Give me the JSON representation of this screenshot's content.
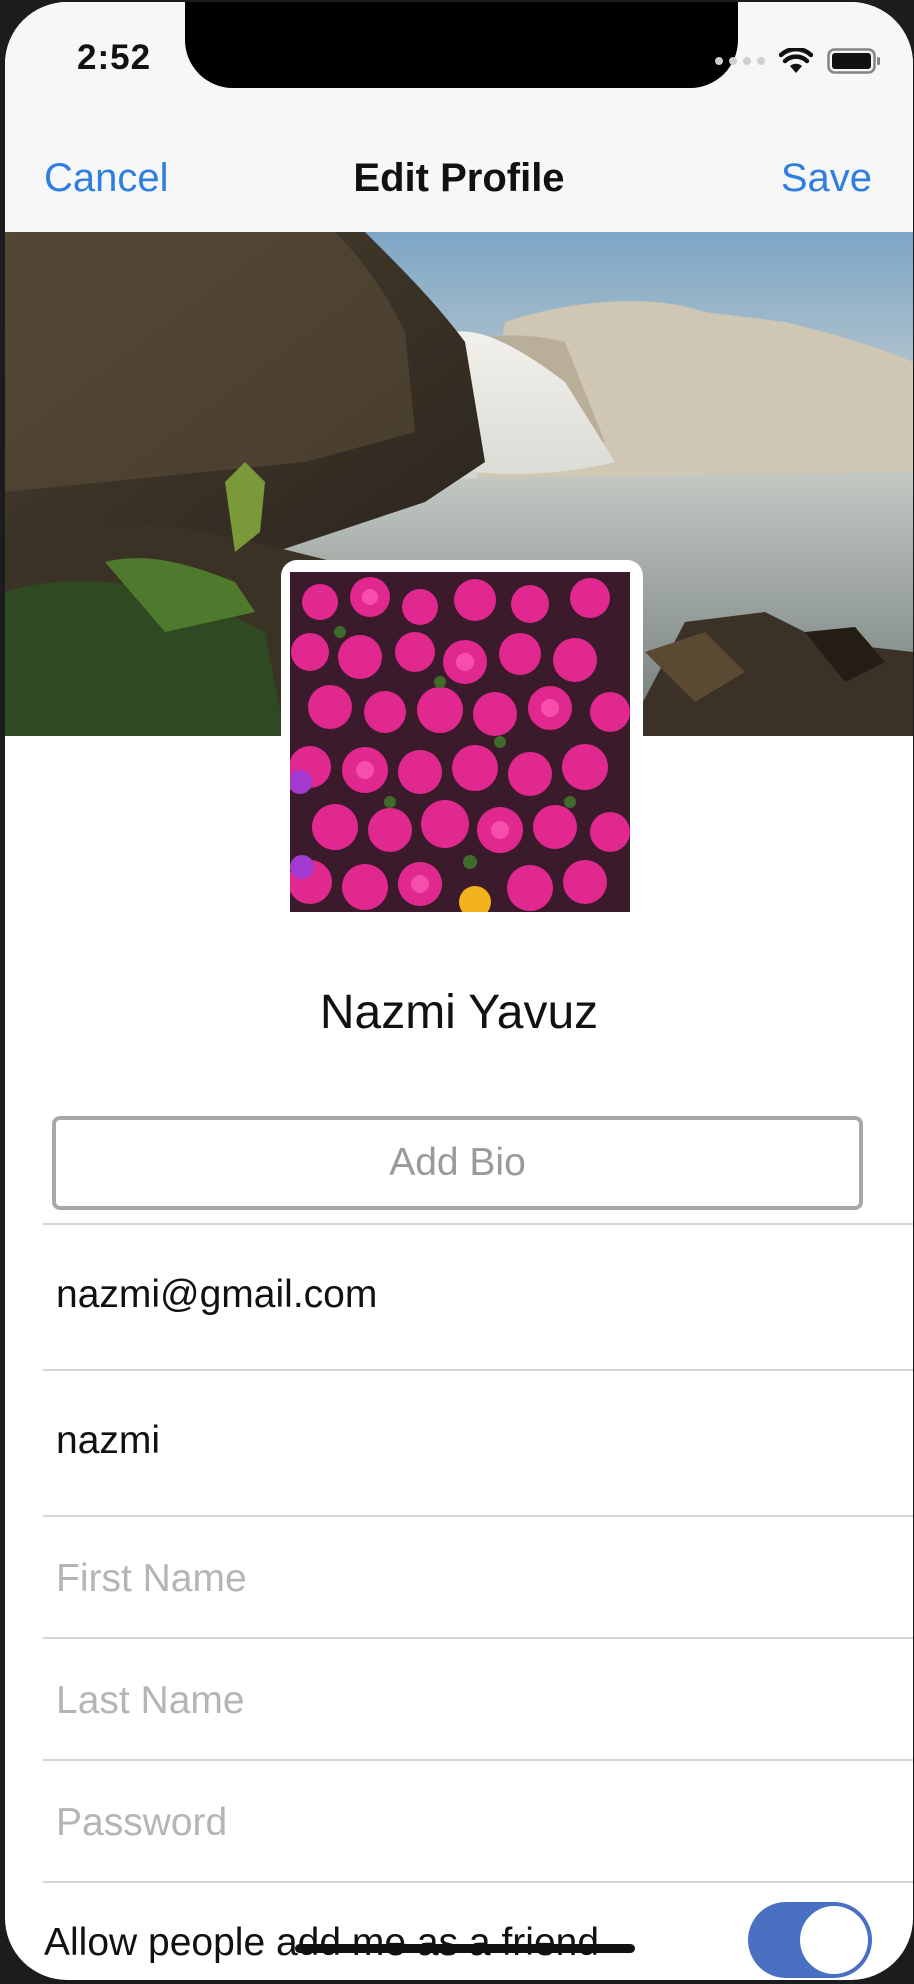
{
  "status": {
    "time": "2:52"
  },
  "nav": {
    "cancel": "Cancel",
    "title": "Edit Profile",
    "save": "Save"
  },
  "profile": {
    "name": "Nazmi Yavuz",
    "bio_button": "Add Bio"
  },
  "fields": {
    "email": {
      "value": "nazmi@gmail.com",
      "placeholder": ""
    },
    "username": {
      "value": "nazmi",
      "placeholder": ""
    },
    "first_name": {
      "value": "",
      "placeholder": "First Name"
    },
    "last_name": {
      "value": "",
      "placeholder": "Last Name"
    },
    "password": {
      "value": "",
      "placeholder": "Password"
    }
  },
  "friend_toggle": {
    "label": "Allow people add me as a friend",
    "on": true
  },
  "colors": {
    "accent": "#2f7fdf",
    "toggle": "#4a70c2",
    "separator": "#d6d6d8"
  }
}
